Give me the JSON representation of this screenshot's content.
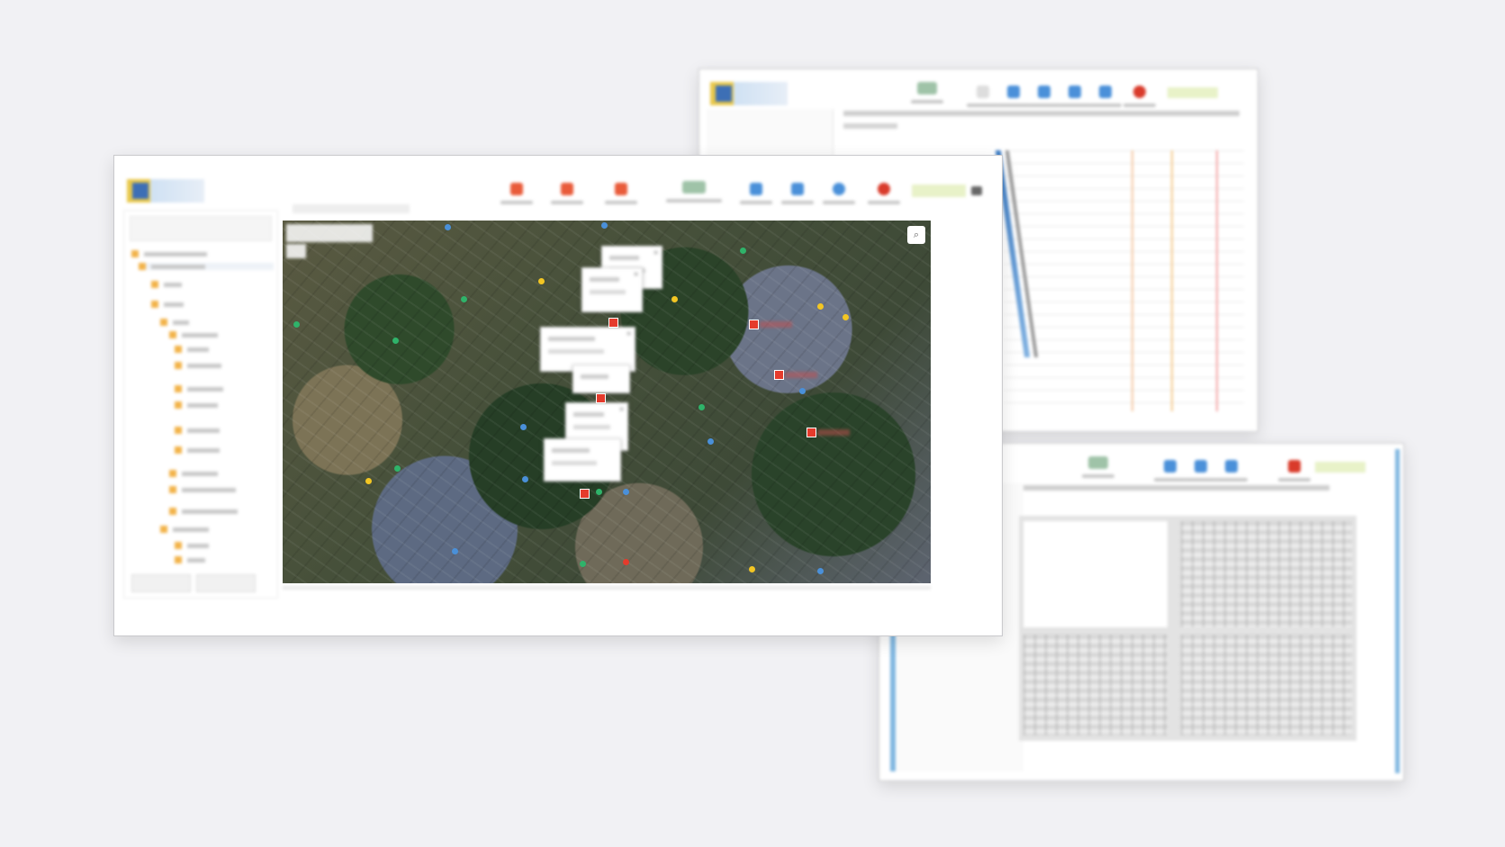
{
  "windows": {
    "main": {
      "title": "",
      "toolbar": [
        {
          "icon": "alarm-icon",
          "color": "#e95b3a"
        },
        {
          "icon": "alarm-icon",
          "color": "#e95b3a"
        },
        {
          "icon": "alarm-icon",
          "color": "#e95b3a"
        },
        {
          "icon": "monitor-icon",
          "color": "#9fc3a8"
        },
        {
          "icon": "download-icon",
          "color": "#4a90d9"
        },
        {
          "icon": "document-icon",
          "color": "#4a90d9"
        },
        {
          "icon": "gear-icon",
          "color": "#4a90d9"
        },
        {
          "icon": "power-icon",
          "color": "#d93b2b"
        }
      ],
      "map": {
        "type": "satellite"
      }
    },
    "top_right": {
      "title": "",
      "chart": "line"
    },
    "bottom_right": {
      "title": "",
      "panels": 4
    }
  },
  "colors": {
    "accent": "#e53b2c",
    "marker_blue": "#4a90d9",
    "marker_green": "#2fb36a",
    "marker_yellow": "#f3c623"
  }
}
